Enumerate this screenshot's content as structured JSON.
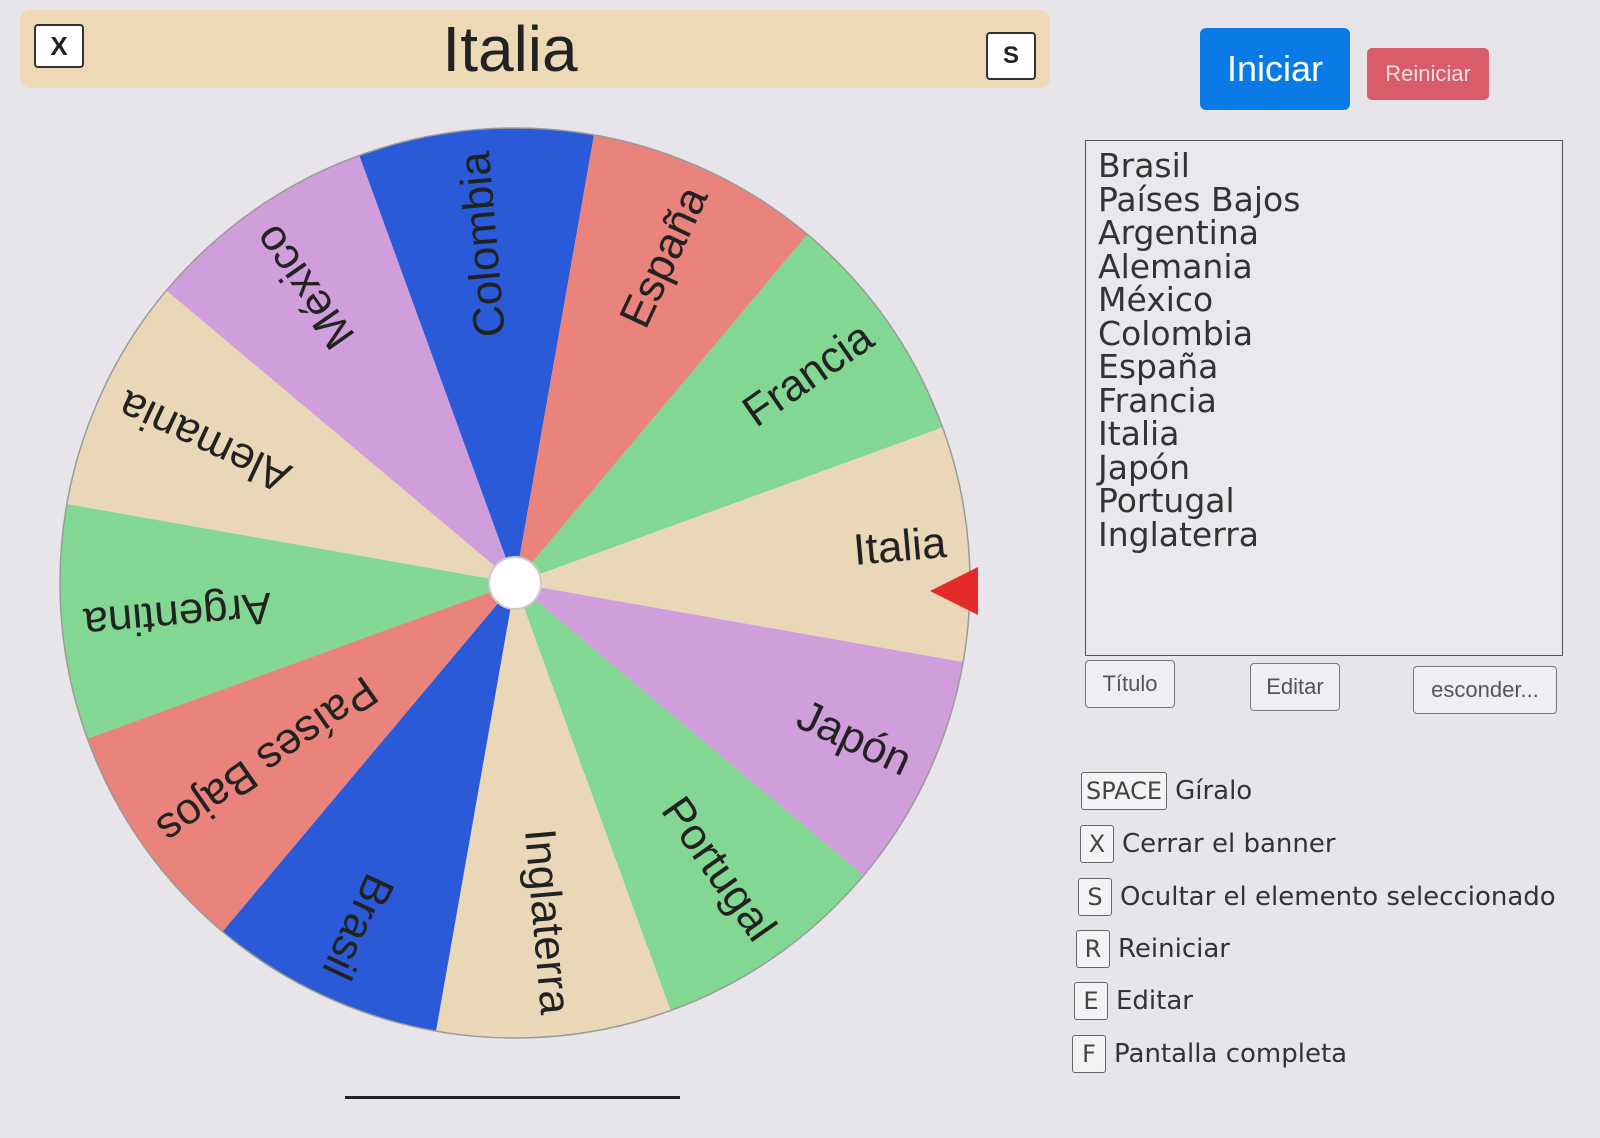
{
  "banner": {
    "close_label": "X",
    "title": "Italia",
    "hide_label": "S"
  },
  "actions": {
    "start_label": "Iniciar",
    "reset_label": "Reiniciar"
  },
  "wheel": {
    "pointer_color": "#e52a2a",
    "selected": "Italia",
    "segments": [
      {
        "label": "Italia",
        "color": "#ead7b8"
      },
      {
        "label": "Japón",
        "color": "#cf9edb"
      },
      {
        "label": "Portugal",
        "color": "#82d893"
      },
      {
        "label": "Inglaterra",
        "color": "#ead7b8"
      },
      {
        "label": "Brasil",
        "color": "#2a5ad8"
      },
      {
        "label": "Países Bajos",
        "color": "#e9837c"
      },
      {
        "label": "Argentina",
        "color": "#82d893"
      },
      {
        "label": "Alemania",
        "color": "#ead7b8"
      },
      {
        "label": "México",
        "color": "#cf9edb"
      },
      {
        "label": "Colombia",
        "color": "#2a5ad8"
      },
      {
        "label": "España",
        "color": "#e9837c"
      },
      {
        "label": "Francia",
        "color": "#82d893"
      }
    ]
  },
  "list": {
    "items": [
      "Brasil",
      "Países Bajos",
      "Argentina",
      "Alemania",
      "México",
      "Colombia",
      "España",
      "Francia",
      "Italia",
      "Japón",
      "Portugal",
      "Inglaterra"
    ]
  },
  "tools": {
    "title_label": "Título",
    "edit_label": "Editar",
    "hide_label": "esconder..."
  },
  "shortcuts": [
    {
      "key": "SPACE",
      "label": "Gíralo"
    },
    {
      "key": "X",
      "label": "Cerrar el banner"
    },
    {
      "key": "S",
      "label": "Ocultar el elemento seleccionado"
    },
    {
      "key": "R",
      "label": "Reiniciar"
    },
    {
      "key": "E",
      "label": "Editar"
    },
    {
      "key": "F",
      "label": "Pantalla completa"
    }
  ]
}
